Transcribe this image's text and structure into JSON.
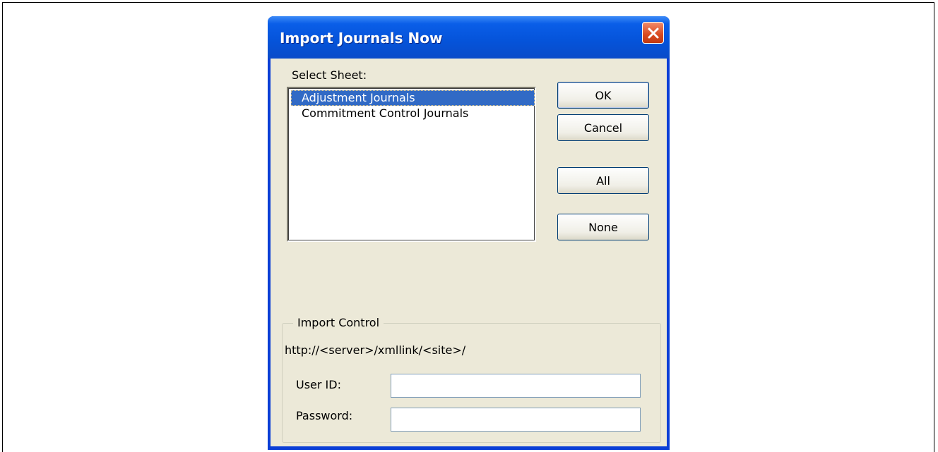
{
  "dialog": {
    "title": "Import Journals Now",
    "close_icon": "close-icon"
  },
  "sheet_select": {
    "label": "Select Sheet:",
    "items": [
      {
        "label": "Adjustment Journals",
        "selected": true
      },
      {
        "label": "Commitment Control Journals",
        "selected": false
      }
    ]
  },
  "buttons": {
    "ok": "OK",
    "cancel": "Cancel",
    "all": "All",
    "none": "None"
  },
  "import_control": {
    "title": "Import Control",
    "url": "http://<server>/xmllink/<site>/",
    "user_id_label": "User ID:",
    "user_id_value": "",
    "password_label": "Password:",
    "password_value": ""
  },
  "colors": {
    "title_bar": "#0553d9",
    "selection": "#316ac5",
    "dialog_face": "#ece9d8",
    "close_button": "#d9481e"
  }
}
